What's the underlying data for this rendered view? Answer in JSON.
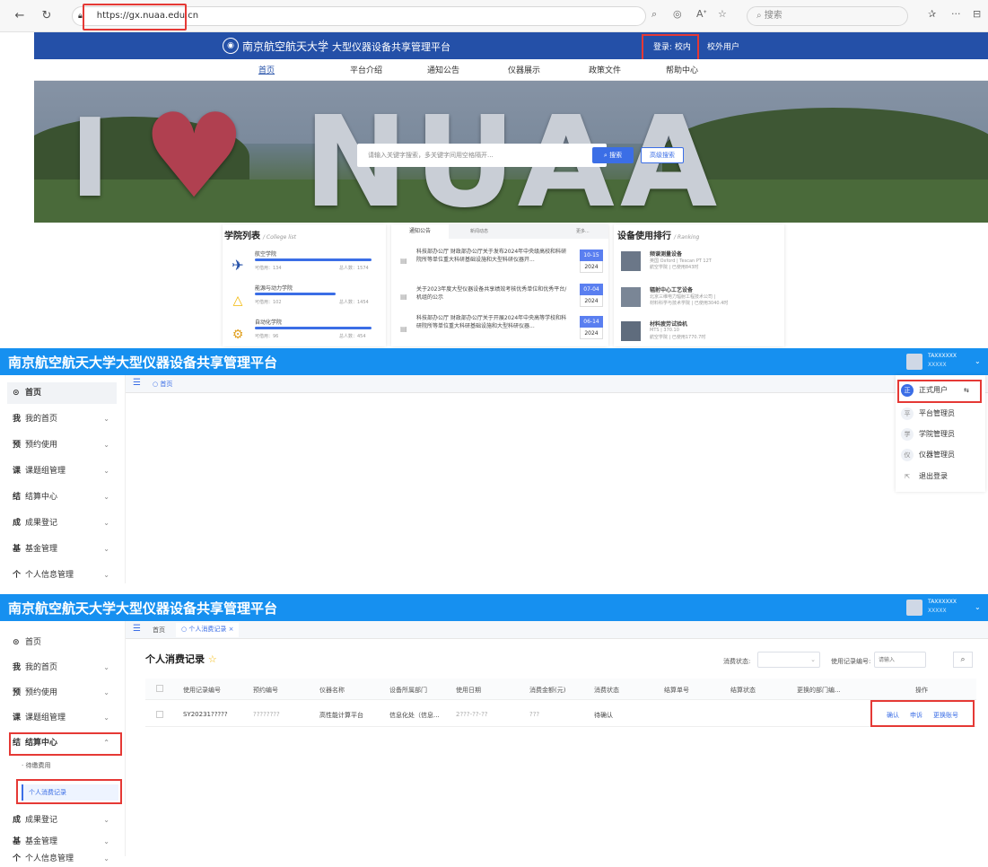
{
  "browser": {
    "url": "https://gx.nuaa.edu.cn",
    "search_placeholder": "搜索"
  },
  "site": {
    "school": "南京航空航天大学",
    "platform": "大型仪器设备共享管理平台",
    "login": "登录: 校内",
    "external": "校外用户",
    "nav": [
      "首页",
      "平台介绍",
      "通知公告",
      "仪器展示",
      "政策文件",
      "帮助中心"
    ],
    "search_placeholder": "请输入关键字搜索，多关键字间用空格隔开...",
    "search_btn": "搜索",
    "adv_btn": "高级搜索",
    "colleges": {
      "title": "学院列表",
      "sub": "/ College list",
      "items": [
        {
          "name": "航空学院",
          "l": "可借用：134",
          "r": "总人数：1574"
        },
        {
          "name": "能源与动力学院",
          "l": "可借用：102",
          "r": "总人数：1454"
        },
        {
          "name": "自动化学院",
          "l": "可借用：96",
          "r": "总人数：454"
        }
      ]
    },
    "notices": {
      "tabs": [
        "通知公告",
        "新闻动态",
        "更多..."
      ],
      "items": [
        {
          "text": "科技部办公厅 财政部办公厅关于发布2024年中央级高校和科研院所等单位重大科研基础设施和大型科研仪器开...",
          "day": "10-15",
          "year": "2024"
        },
        {
          "text": "关于2023年度大型仪器设备共享绩效考核优秀单位和优秀平台/机组的公示",
          "day": "07-04",
          "year": "2024"
        },
        {
          "text": "科技部办公厅 财政部办公厅关于开展2024年中央高等学校和科研院所等单位重大科研基础设施和大型科研仪器...",
          "day": "06-14",
          "year": "2024"
        }
      ]
    },
    "ranking": {
      "title": "设备使用排行",
      "sub": "/ Ranking",
      "items": [
        {
          "name": "频谱测量设备",
          "l1": "英国 Oxford | Tescan PT 12T",
          "l2": "航空学院 | 已使用843时"
        },
        {
          "name": "辐射中心工艺设备",
          "l1": "北京三维电力辐射工程技术公司 |",
          "l2": "材料科学与技术学院 | 已使用3040.4时"
        },
        {
          "name": "材料疲劳试验机",
          "l1": "MTS | 370.10",
          "l2": "航空学院 | 已使用1770.7时"
        }
      ]
    }
  },
  "admin": {
    "title": "南京航空航天大学大型仪器设备共享管理平台",
    "user_name": "TAXXXXXX",
    "user_sub": "XXXXX",
    "tab_home": "首页",
    "sidebar": [
      {
        "icon": "⊙",
        "label": "首页"
      },
      {
        "icon": "我",
        "label": "我的首页"
      },
      {
        "icon": "预",
        "label": "预约使用"
      },
      {
        "icon": "课",
        "label": "课题组管理"
      },
      {
        "icon": "结",
        "label": "结算中心"
      },
      {
        "icon": "成",
        "label": "成果登记"
      },
      {
        "icon": "基",
        "label": "基金管理"
      },
      {
        "icon": "个",
        "label": "个人信息管理"
      }
    ],
    "role_menu": [
      {
        "icon": "正",
        "label": "正式用户",
        "extra": "⇆"
      },
      {
        "icon": "平",
        "label": "平台管理员"
      },
      {
        "icon": "学",
        "label": "学院管理员"
      },
      {
        "icon": "仪",
        "label": "仪器管理员"
      },
      {
        "icon": "⇱",
        "label": "退出登录"
      }
    ]
  },
  "records": {
    "tab_active": "个人消费记录",
    "page_title": "个人消费记录",
    "submenu": [
      "待缴费用",
      "个人消费记录"
    ],
    "filter": {
      "status_label": "消费状态:",
      "code_label": "使用记录编号:",
      "code_placeholder": "请输入"
    },
    "columns": [
      "使用记录编号",
      "预约编号",
      "仪器名称",
      "设备所属部门",
      "使用日期",
      "消费金额(元)",
      "消费状态",
      "结算单号",
      "结算状态",
      "更换的部门编...",
      "操作"
    ],
    "row": {
      "code": "SY20231?????",
      "appt": "????????",
      "instrument": "高性能计算平台",
      "dept": "信息化处（信息...",
      "date": "2???-??-??",
      "amount": "???",
      "status": "待确认",
      "actions": [
        "确认",
        "申诉",
        "更换账号"
      ]
    }
  }
}
